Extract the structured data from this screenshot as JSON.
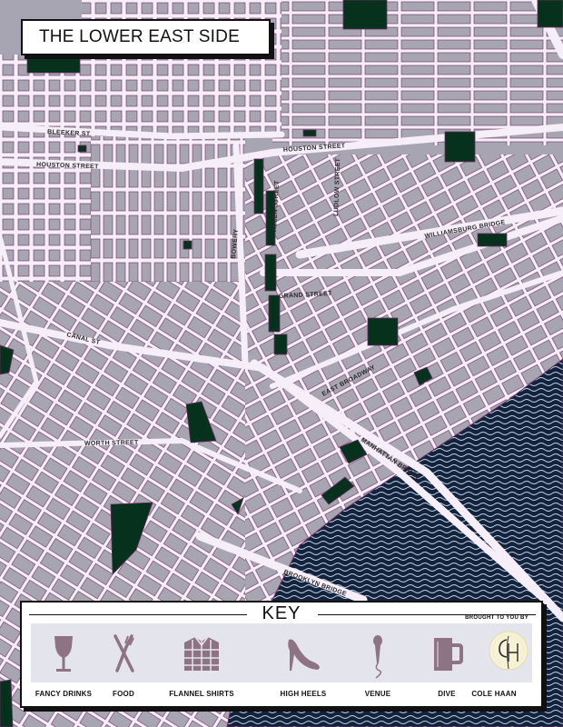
{
  "map": {
    "title": "THE LOWER EAST SIDE",
    "streets": {
      "bleeker": "BLEEKER ST",
      "houston_west": "HOUSTON STREET",
      "houston_east": "HOUSTON STREET",
      "bowery": "BOWERY",
      "allen": "ALLEN STREET",
      "ludlow": "LUDLOW STREET",
      "williamsburg": "WILLIAMSBURG BRIDGE",
      "grand": "GRAND STREET",
      "canal": "CANAL ST",
      "east_broadway": "EAST BROADWAY",
      "worth": "WORTH STREET",
      "manhattan_bridge": "MANHATTAN BRIDGE",
      "brooklyn_bridge": "BROOKLYN BRIDGE"
    },
    "colors": {
      "block": "#a8a5b3",
      "street": "#f6eef9",
      "outline": "#6b2d5e",
      "park": "#06321d",
      "water": "#12233d",
      "icon": "#8e7384"
    }
  },
  "key": {
    "title": "KEY",
    "sponsor_text": "BROUGHT TO YOU BY",
    "items": [
      {
        "label": "FANCY DRINKS",
        "icon": "wine-glass-icon"
      },
      {
        "label": "FOOD",
        "icon": "fork-knife-icon"
      },
      {
        "label": "FLANNEL SHIRTS",
        "icon": "flannel-shirt-icon"
      },
      {
        "label": "HIGH HEELS",
        "icon": "high-heel-icon"
      },
      {
        "label": "VENUE",
        "icon": "microphone-icon"
      },
      {
        "label": "DIVE",
        "icon": "beer-mug-icon"
      },
      {
        "label": "COLE HAAN",
        "icon": "cole-haan-logo-icon"
      }
    ]
  }
}
